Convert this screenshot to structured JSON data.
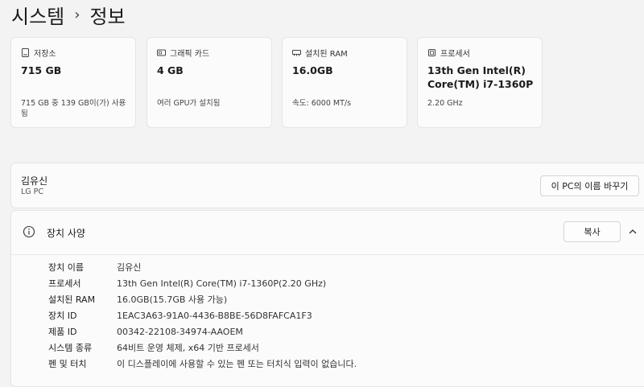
{
  "breadcrumb": {
    "parent": "시스템",
    "separator": "›",
    "current": "정보"
  },
  "cards": [
    {
      "icon": "storage-icon",
      "title": "저장소",
      "value": "715 GB",
      "sub": "715 GB 중 139 GB이(가) 사용됨"
    },
    {
      "icon": "graphics-card-icon",
      "title": "그래픽 카드",
      "value": "4 GB",
      "sub": "여러 GPU가 설치됨"
    },
    {
      "icon": "ram-icon",
      "title": "설치된 RAM",
      "value": "16.0GB",
      "sub": "속도: 6000 MT/s"
    },
    {
      "icon": "processor-icon",
      "title": "프로세서",
      "value": "13th Gen Intel(R) Core(TM) i7-1360P",
      "sub": "2.20 GHz"
    }
  ],
  "device": {
    "name": "김유신",
    "model": "LG PC",
    "rename_label": "이 PC의 이름 바꾸기"
  },
  "spec": {
    "title": "장치 사양",
    "copy_label": "복사",
    "rows": [
      {
        "key": "장치 이름",
        "value": "김유신"
      },
      {
        "key": "프로세서",
        "value": "13th Gen Intel(R) Core(TM) i7-1360P(2.20 GHz)"
      },
      {
        "key": "설치된 RAM",
        "value": "16.0GB(15.7GB 사용 가능)"
      },
      {
        "key": "장치 ID",
        "value": "1EAC3A63-91A0-4436-B8BE-56D8FAFCA1F3"
      },
      {
        "key": "제품 ID",
        "value": "00342-22108-34974-AAOEM"
      },
      {
        "key": "시스템 종류",
        "value": "64비트 운영 체제, x64 기반 프로세서"
      },
      {
        "key": "펜 및 터치",
        "value": "이 디스플레이에 사용할 수 있는 펜 또는 터치식 입력이 없습니다."
      }
    ]
  }
}
